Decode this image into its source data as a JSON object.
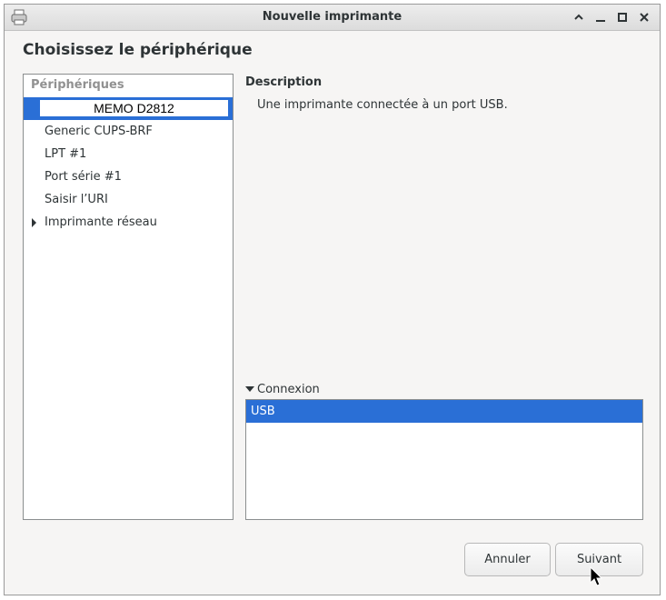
{
  "window": {
    "title": "Nouvelle imprimante"
  },
  "page": {
    "heading": "Choisissez le périphérique"
  },
  "devices": {
    "header": "Périphériques",
    "editing_value": "MEMO D2812",
    "items": [
      {
        "label": "Generic CUPS-BRF"
      },
      {
        "label": "LPT #1"
      },
      {
        "label": "Port série #1"
      },
      {
        "label": "Saisir l’URI"
      },
      {
        "label": "Imprimante réseau"
      }
    ]
  },
  "description": {
    "title": "Description",
    "text": "Une imprimante connectée à un port USB."
  },
  "connection": {
    "label": "Connexion",
    "items": [
      {
        "label": "USB"
      }
    ]
  },
  "buttons": {
    "cancel": "Annuler",
    "next": "Suivant"
  },
  "colors": {
    "selection": "#2a6fd6"
  },
  "icons": {
    "window_icon": "printer-icon",
    "wm": [
      "maximize-icon",
      "minimize-icon",
      "restore-icon",
      "close-icon"
    ],
    "expander": "triangle-right-icon",
    "connection_expander": "triangle-down-icon"
  }
}
